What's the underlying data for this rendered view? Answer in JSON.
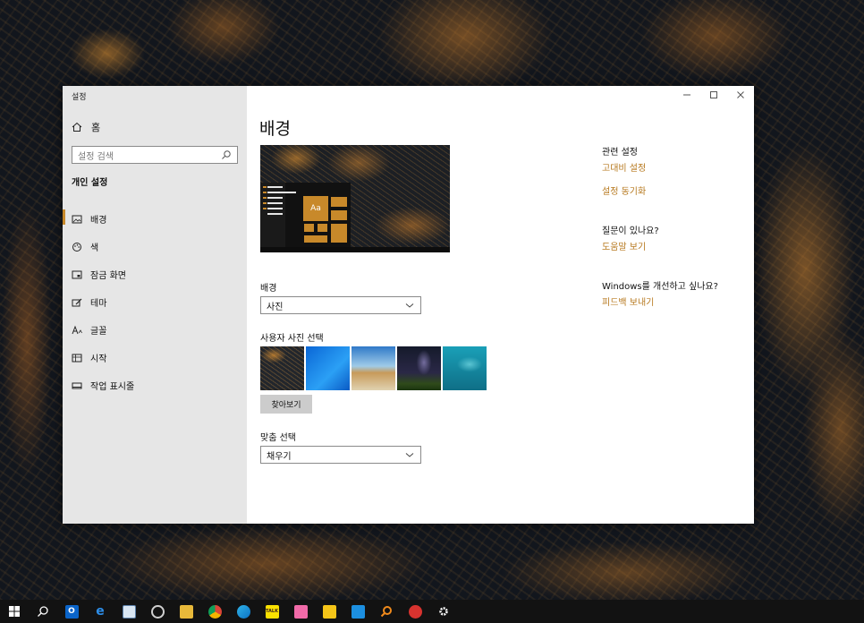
{
  "window": {
    "title": "설정",
    "minimize_icon": "minimize-icon",
    "maximize_icon": "maximize-icon",
    "close_icon": "close-icon"
  },
  "sidebar": {
    "home_label": "홈",
    "search_placeholder": "설정 검색",
    "section_title": "개인 설정",
    "items": [
      {
        "label": "배경",
        "icon": "image-icon",
        "active": true
      },
      {
        "label": "색",
        "icon": "palette-icon",
        "active": false
      },
      {
        "label": "잠금 화면",
        "icon": "lock-screen-icon",
        "active": false
      },
      {
        "label": "테마",
        "icon": "theme-icon",
        "active": false
      },
      {
        "label": "글꼴",
        "icon": "font-icon",
        "active": false
      },
      {
        "label": "시작",
        "icon": "start-icon",
        "active": false
      },
      {
        "label": "작업 표시줄",
        "icon": "taskbar-icon",
        "active": false
      }
    ]
  },
  "main": {
    "title": "배경",
    "preview_text": "Aa",
    "background_label": "배경",
    "background_value": "사진",
    "choose_picture_label": "사용자 사진 선택",
    "browse_label": "찾아보기",
    "fit_label": "맞춤 선택",
    "fit_value": "채우기"
  },
  "related": {
    "heading": "관련 설정",
    "link1": "고대비 설정",
    "link2": "설정 동기화",
    "question_heading": "질문이 있나요?",
    "help_link": "도움말 보기",
    "improve_heading": "Windows를 개선하고 싶나요?",
    "feedback_link": "피드백 보내기"
  },
  "colors": {
    "accent": "#c8892a",
    "link": "#b7791f",
    "sidebar_bg": "#e6e6e6",
    "taskbar_bg": "#121212"
  },
  "taskbar": {
    "icons": [
      "start-icon",
      "search-icon",
      "outlook-icon",
      "edge-icon",
      "notepad-icon",
      "recycle-icon",
      "file-explorer-icon",
      "chrome-icon",
      "app-icon",
      "kakaotalk-icon",
      "app2-icon",
      "app3-icon",
      "app4-icon",
      "magnifier-icon",
      "app5-icon",
      "settings-icon"
    ],
    "kakaotalk_text": "TALK"
  }
}
